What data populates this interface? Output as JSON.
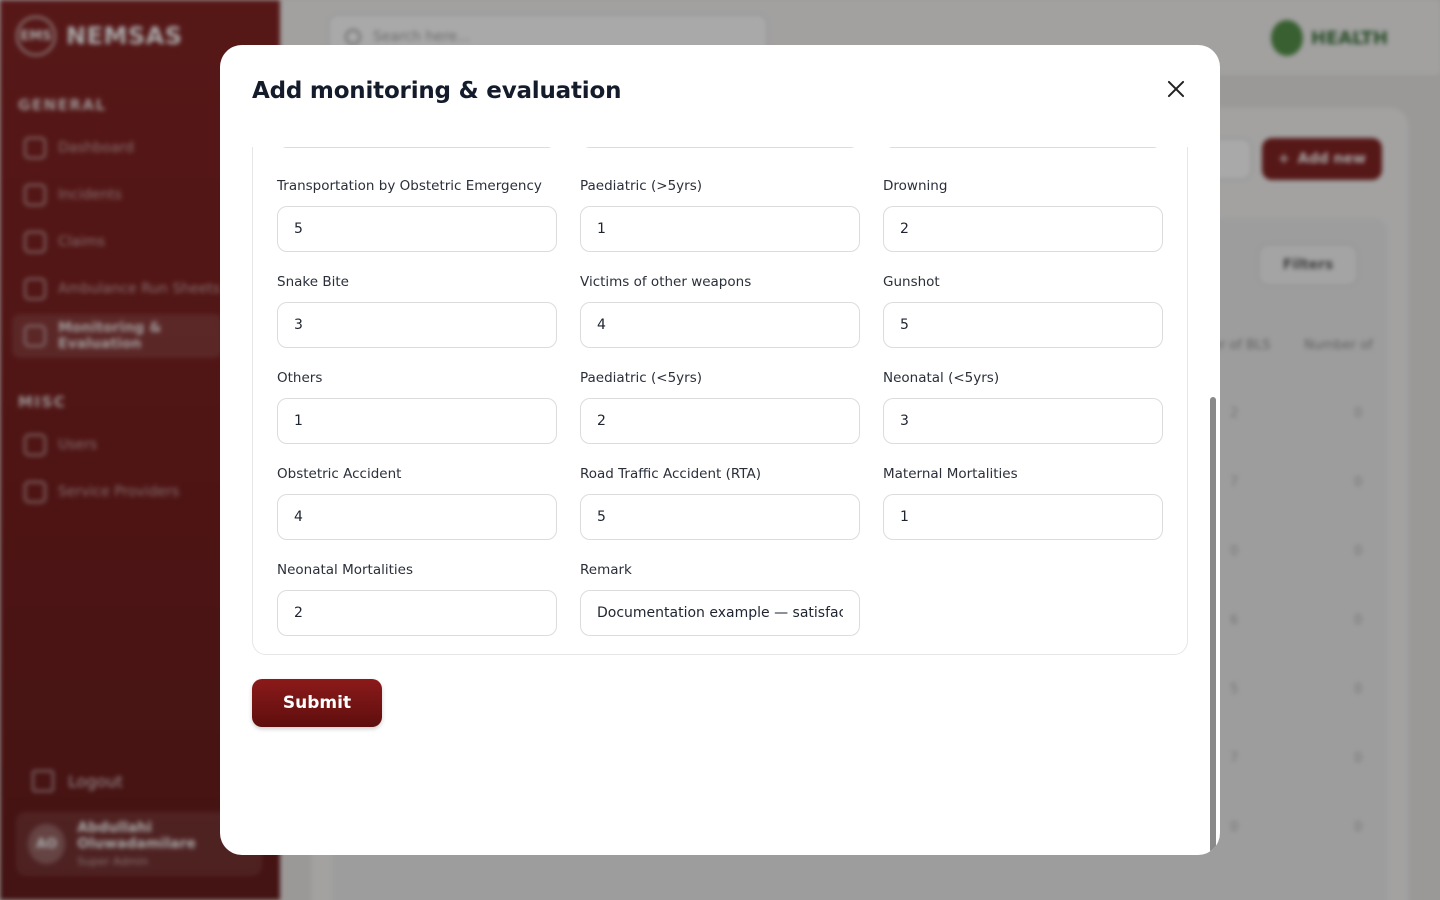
{
  "sidebar": {
    "brand": "NEMSAS",
    "brand_logo": "EMS",
    "general_title": "GENERAL",
    "misc_title": "MISC",
    "items": [
      {
        "label": "Dashboard",
        "icon": "grid-icon"
      },
      {
        "label": "Incidents",
        "icon": "alert-icon"
      },
      {
        "label": "Claims",
        "icon": "clipboard-icon"
      },
      {
        "label": "Ambulance Run Sheets",
        "icon": "ambulance-icon"
      },
      {
        "label": "Monitoring & Evaluation",
        "icon": "chart-icon"
      }
    ],
    "misc_items": [
      {
        "label": "Users",
        "icon": "users-icon"
      },
      {
        "label": "Service Providers",
        "icon": "building-icon"
      }
    ],
    "logout": "Logout",
    "user": {
      "initials": "AO",
      "name": "Abdullahi Oluwadamilare",
      "role": "Super Admin"
    }
  },
  "topbar": {
    "search_placeholder": "Search here...",
    "logo_text": "HEALTH"
  },
  "content": {
    "add_new": "Add new",
    "filters": "Filters",
    "headers": [
      "er of BLS",
      "Number of"
    ],
    "rows_partial": [
      "2",
      "7",
      "0",
      "6",
      "5",
      "7",
      "0"
    ],
    "row_zero": "0"
  },
  "modal": {
    "title": "Add monitoring & evaluation",
    "submit": "Submit",
    "fields": [
      {
        "label": "Transportation by Obstetric Emergency",
        "value": "5"
      },
      {
        "label": "Paediatric (>5yrs)",
        "value": "1"
      },
      {
        "label": "Drowning",
        "value": "2"
      },
      {
        "label": "Snake Bite",
        "value": "3"
      },
      {
        "label": "Victims of other weapons",
        "value": "4"
      },
      {
        "label": "Gunshot",
        "value": "5"
      },
      {
        "label": "Others",
        "value": "1"
      },
      {
        "label": "Paediatric (<5yrs)",
        "value": "2"
      },
      {
        "label": "Neonatal (<5yrs)",
        "value": "3"
      },
      {
        "label": "Obstetric Accident",
        "value": "4"
      },
      {
        "label": "Road Traffic Accident (RTA)",
        "value": "5"
      },
      {
        "label": "Maternal Mortalities",
        "value": "1"
      },
      {
        "label": "Neonatal Mortalities",
        "value": "2"
      },
      {
        "label": "Remark",
        "value": "Documentation example — satisfactory"
      }
    ]
  },
  "colors": {
    "brand": "#7a1414",
    "submit_gradient_top": "#8c1a1a",
    "submit_gradient_bottom": "#5e0e0e"
  }
}
